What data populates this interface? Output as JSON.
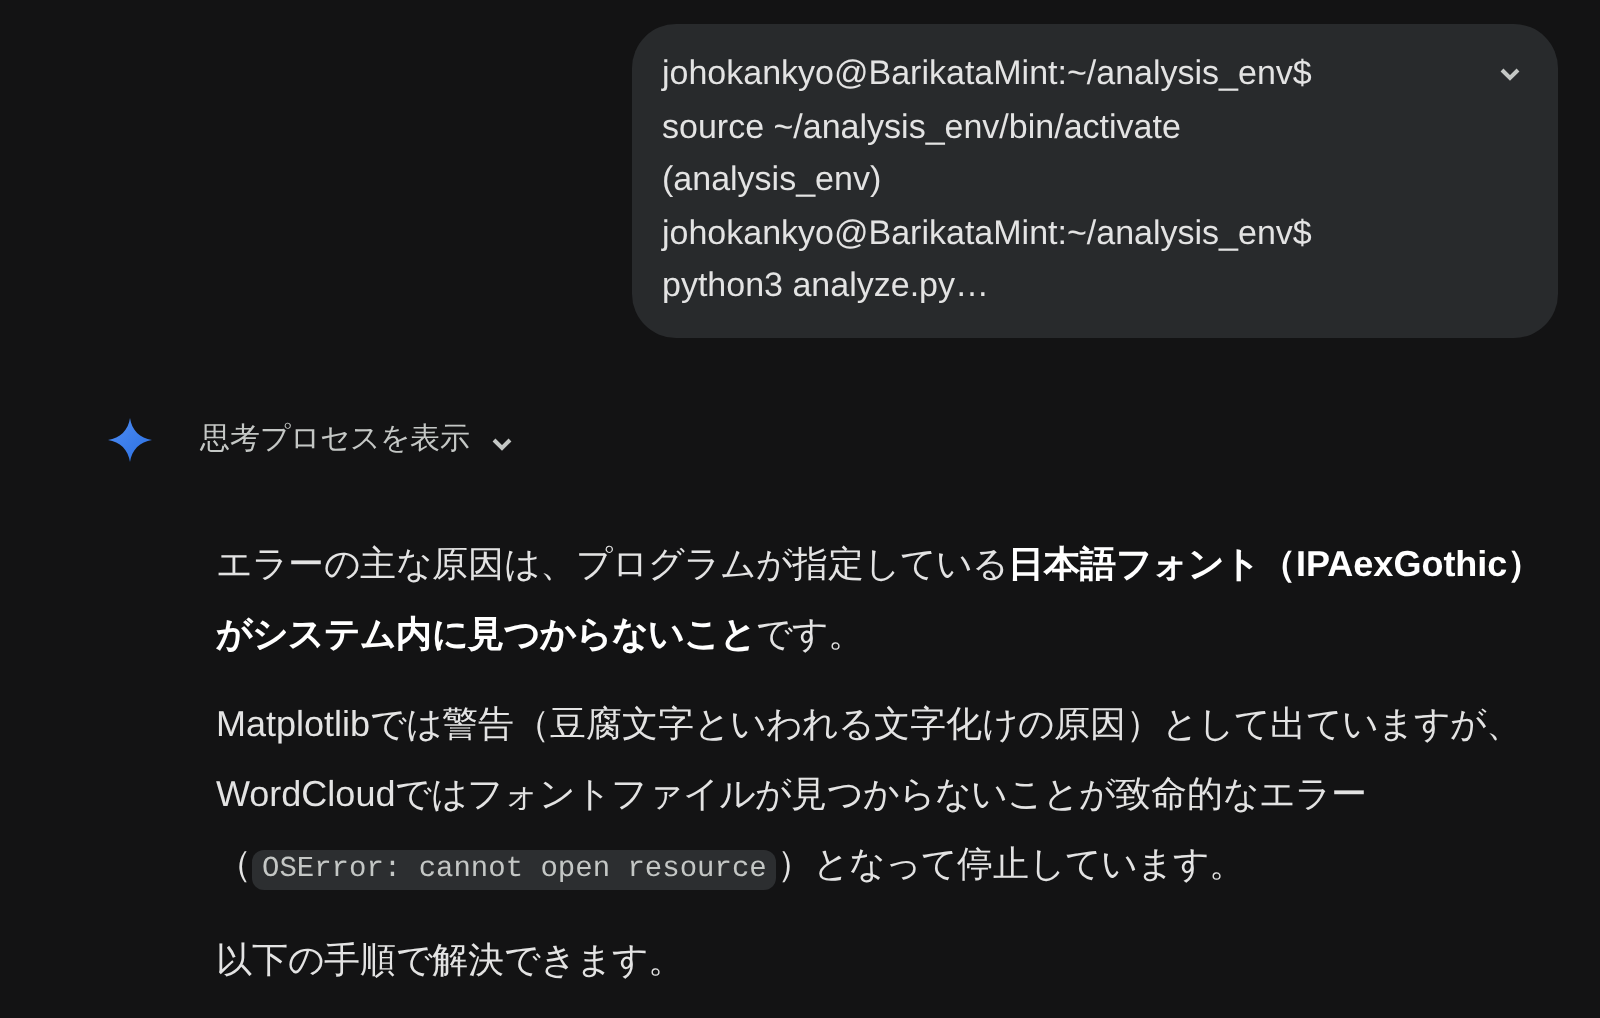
{
  "user_message": {
    "lines": [
      "johokankyo@BarikataMint:~/analysis_env$",
      "source ~/analysis_env/bin/activate",
      "(analysis_env)",
      "johokankyo@BarikataMint:~/analysis_env$",
      "python3 analyze.py…"
    ],
    "expanded": false
  },
  "thoughts_toggle": {
    "label": "思考プロセスを表示",
    "expanded": false
  },
  "paragraphs": [
    [
      {
        "kind": "text",
        "text": "エラーの主な原因は、プログラムが指定している**日本語フォント（IPAexGothic）がシステム内に見つからないこと**です。"
      }
    ],
    [
      {
        "kind": "text",
        "text": "Matplotlibでは警告（豆腐文字といわれる文字化けの原因）として出ていますが、WordCloudではフォントファイルが見つからないことが致命的なエラー（"
      },
      {
        "kind": "code",
        "text": "OSError: cannot open resource"
      },
      {
        "kind": "text",
        "text": "）となって停止しています。"
      }
    ],
    [
      {
        "kind": "text",
        "text": "以下の手順で解決できます。"
      }
    ]
  ]
}
